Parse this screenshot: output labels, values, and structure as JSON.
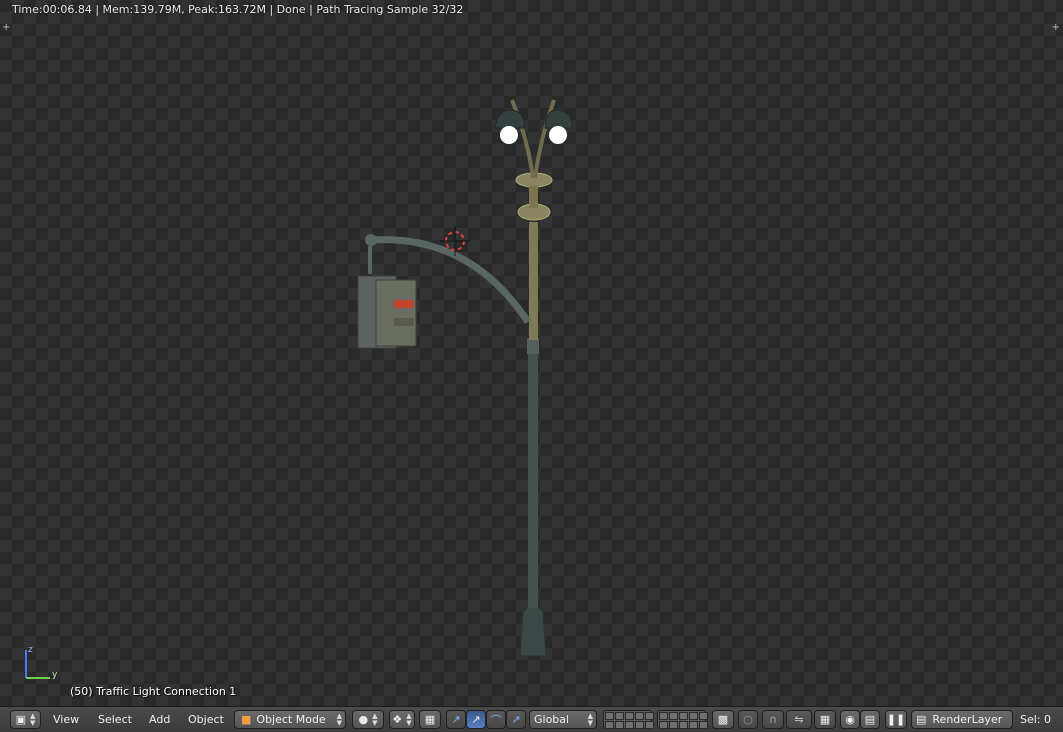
{
  "viewport": {
    "status_text": "Time:00:06.84 | Mem:139.79M, Peak:163.72M | Done | Path Tracing Sample 32/32",
    "object_info": "(50) Traffic Light Connection 1",
    "axis_labels": {
      "z": "z",
      "y": "y"
    }
  },
  "header": {
    "editor_type_icon": "cube-icon",
    "menus": {
      "view": "View",
      "select": "Select",
      "add": "Add",
      "object": "Object"
    },
    "mode_label": "Object Mode",
    "viewport_shading_icon": "sphere-icon",
    "pivot_icon": "pivot-icon",
    "transform_orientation": "Global",
    "render_layer": "RenderLayer",
    "selection_count": "Sel: 0"
  },
  "colors": {
    "accent_blue": "#5680c2",
    "axis_z": "#4a7bff",
    "axis_y": "#6bd14a",
    "pole": "#3e4a47"
  }
}
